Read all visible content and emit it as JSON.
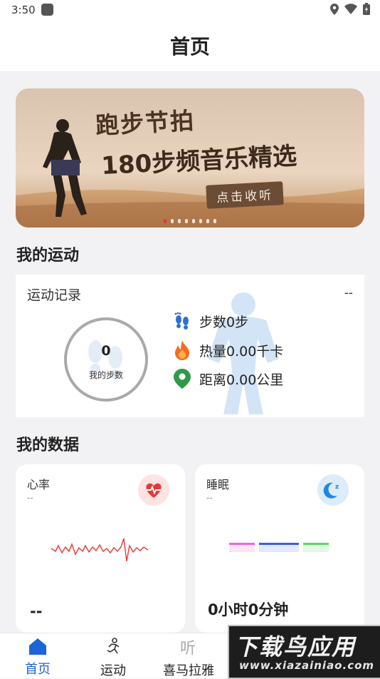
{
  "status_bar": {
    "time": "3:50"
  },
  "header": {
    "title": "首页"
  },
  "banner": {
    "line1": "跑步节拍",
    "line2": "180步频音乐精选",
    "cta": "点击收听",
    "active_index": 0,
    "count": 8
  },
  "my_sport": {
    "section_title": "我的运动",
    "card_title": "运动记录",
    "card_value": "--",
    "steps_value": "0",
    "steps_label": "我的步数",
    "stats": [
      {
        "icon": "footprints-icon",
        "text": "步数0步"
      },
      {
        "icon": "flame-icon",
        "text": "热量0.00千卡"
      },
      {
        "icon": "location-pin-icon",
        "text": "距离0.00公里"
      }
    ]
  },
  "my_data": {
    "section_title": "我的数据",
    "heart": {
      "title": "心率",
      "sub": "--",
      "value": "--"
    },
    "sleep": {
      "title": "睡眠",
      "sub": "--",
      "value": "0小时0分钟"
    }
  },
  "tabs": [
    {
      "label": "首页",
      "icon": "home-icon",
      "active": true
    },
    {
      "label": "运动",
      "icon": "running-icon",
      "active": false
    },
    {
      "label": "喜马拉雅",
      "icon": "listen-icon",
      "active": false
    }
  ],
  "watermark": {
    "line1": "下载鸟应用",
    "line2": "www.xiazainiao.com"
  },
  "colors": {
    "accent": "#1d63d6",
    "heart": "#e53935",
    "sleep": "#1e88e5"
  }
}
